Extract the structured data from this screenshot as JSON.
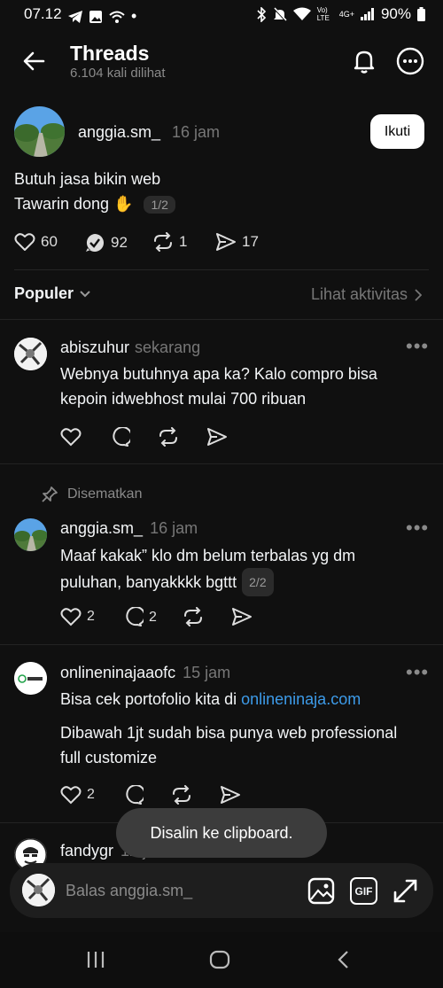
{
  "status_bar": {
    "time": "07.12",
    "battery": "90%",
    "net": "Vo) LTE",
    "net2": "4G+"
  },
  "header": {
    "title": "Threads",
    "subtitle": "6.104 kali dilihat"
  },
  "post": {
    "username": "anggia.sm_",
    "time": "16 jam",
    "follow_label": "Ikuti",
    "line1": "Butuh jasa bikin web",
    "line2": "Tawarin dong ✋",
    "counter": "1/2",
    "likes": "60",
    "quotes": "92",
    "reposts": "1",
    "shares": "17"
  },
  "sort": {
    "label": "Populer",
    "activity_label": "Lihat aktivitas"
  },
  "comments": [
    {
      "username": "abiszuhur",
      "time": "sekarang",
      "line1": "Webnya butuhnya apa ka? Kalo compro bisa",
      "line2": "kepoin idwebhost mulai 700 ribuan"
    },
    {
      "pinned_label": "Disematkan",
      "username": "anggia.sm_",
      "time": "16 jam",
      "line1": "Maaf kakak” klo dm belum terbalas yg dm",
      "line2": "puluhan, banyakkkk bgttt",
      "counter": "2/2",
      "likes": "2",
      "replies": "2"
    },
    {
      "username": "onlineninajaaofc",
      "time": "15 jam",
      "line1_prefix": "Bisa cek portofolio kita di ",
      "link": "onlineninaja.com",
      "line2": "Dibawah 1jt sudah bisa punya web professional",
      "line3": "full customize",
      "likes": "2"
    },
    {
      "username": "fandygr",
      "time": "12 jam"
    }
  ],
  "toast": "Disalin ke clipboard.",
  "reply": {
    "placeholder": "Balas anggia.sm_",
    "gif_label": "GIF"
  },
  "colors": {
    "background": "#101010",
    "link": "#3d9be9",
    "muted": "#777777"
  }
}
